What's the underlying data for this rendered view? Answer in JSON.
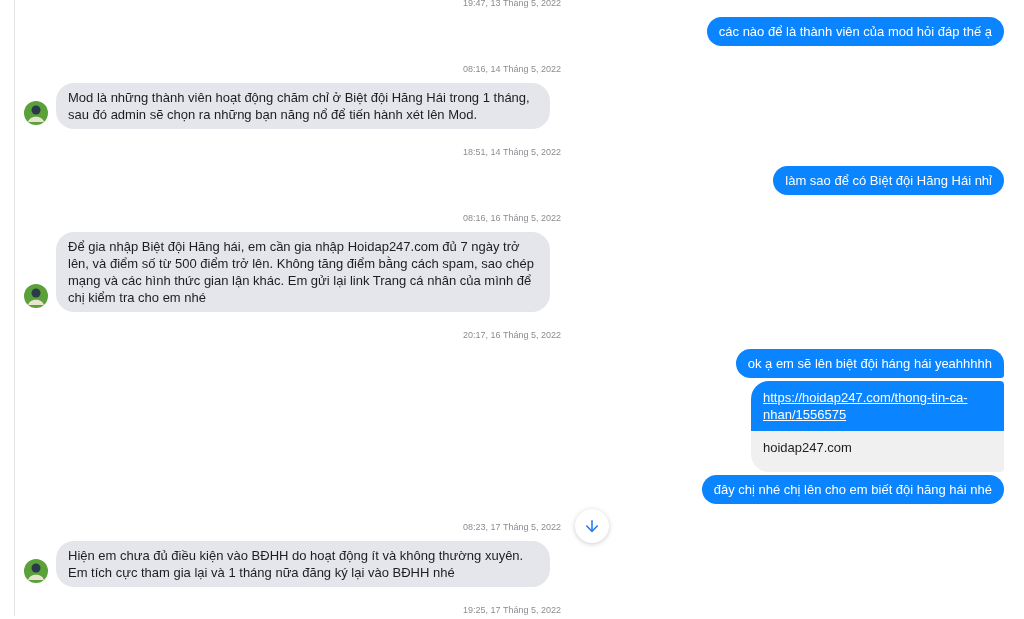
{
  "messages": [
    {
      "kind": "timestamp",
      "text": "19:47, 13 Tháng 5, 2022"
    },
    {
      "kind": "outgoing",
      "text": "các nào để là thành viên của mod hỏi đáp thế ạ",
      "grouped": false
    },
    {
      "kind": "timestamp",
      "text": "08:16, 14 Tháng 5, 2022"
    },
    {
      "kind": "incoming",
      "text": "Mod là những thành viên hoạt động chăm chỉ ở Biệt đội Hăng Hái trong 1 tháng, sau đó admin sẽ chọn ra những bạn năng nổ để tiến hành xét lên Mod."
    },
    {
      "kind": "timestamp",
      "text": "18:51, 14 Tháng 5, 2022"
    },
    {
      "kind": "outgoing",
      "text": "làm sao để có Biệt đội Hăng Hái nhỉ",
      "grouped": false
    },
    {
      "kind": "timestamp",
      "text": "08:16, 16 Tháng 5, 2022"
    },
    {
      "kind": "incoming",
      "text": "Để gia nhập Biệt đội Hăng hái, em cần gia nhập Hoidap247.com đủ 7 ngày trở lên, và điểm số từ 500 điểm trở lên. Không tăng điểm bằng cách spam, sao chép mạng và các hình thức gian lận khác. Em gửi lại link Trang cá nhân của mình để chị kiểm tra cho em nhé"
    },
    {
      "kind": "timestamp",
      "text": "20:17, 16 Tháng 5, 2022"
    },
    {
      "kind": "outgoing",
      "text": "ok ạ em sẽ lên biệt đội háng hái yeahhhhh",
      "grouped": true
    },
    {
      "kind": "link",
      "url": "https://hoidap247.com/thong-tin-ca-nhan/1556575",
      "domain": "hoidap247.com",
      "grouped": true
    },
    {
      "kind": "outgoing",
      "text": "đây chị nhé chị lên cho em biết đội hăng hái nhé",
      "grouped": false
    },
    {
      "kind": "timestamp",
      "text": "08:23, 17 Tháng 5, 2022"
    },
    {
      "kind": "incoming",
      "text": "Hiện em chưa đủ điều kiện vào BĐHH do hoạt động ít và không thường xuyên. Em tích cực tham gia lại và 1 tháng nữa đăng ký lại vào BĐHH nhé"
    },
    {
      "kind": "timestamp",
      "text": "19:25, 17 Tháng 5, 2022"
    }
  ]
}
